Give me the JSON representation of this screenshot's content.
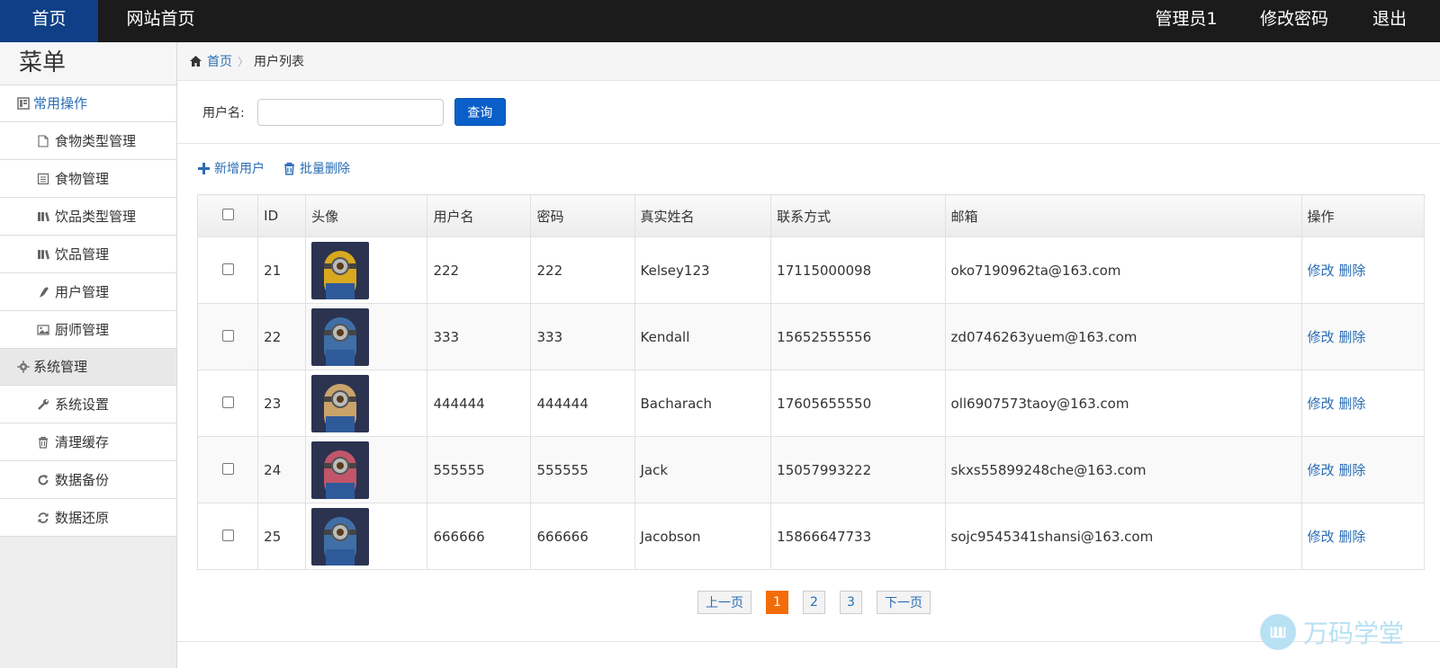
{
  "topbar": {
    "home": "首页",
    "site_home": "网站首页",
    "admin": "管理员1",
    "change_password": "修改密码",
    "logout": "退出"
  },
  "sidebar": {
    "title": "菜单",
    "group1": {
      "label": "常用操作",
      "icon": "list-icon"
    },
    "items1": [
      {
        "label": "食物类型管理",
        "icon": "file-icon"
      },
      {
        "label": "食物管理",
        "icon": "document-icon"
      },
      {
        "label": "饮品类型管理",
        "icon": "books-icon"
      },
      {
        "label": "饮品管理",
        "icon": "books-icon"
      },
      {
        "label": "用户管理",
        "icon": "user-icon"
      },
      {
        "label": "厨师管理",
        "icon": "image-icon"
      }
    ],
    "group2": {
      "label": "系统管理",
      "icon": "gear-icon"
    },
    "items2": [
      {
        "label": "系统设置",
        "icon": "wrench-icon"
      },
      {
        "label": "清理缓存",
        "icon": "trash-icon"
      },
      {
        "label": "数据备份",
        "icon": "refresh-icon"
      },
      {
        "label": "数据还原",
        "icon": "sync-icon"
      }
    ]
  },
  "breadcrumb": {
    "home": "首页",
    "sep": "〉",
    "current": "用户列表"
  },
  "search": {
    "label": "用户名:",
    "value": "",
    "placeholder": "",
    "button": "查询"
  },
  "actions": {
    "add": "新增用户",
    "batch_delete": "批量删除"
  },
  "table": {
    "headers": [
      "ID",
      "头像",
      "用户名",
      "密码",
      "真实姓名",
      "联系方式",
      "邮箱",
      "操作"
    ],
    "rows": [
      {
        "id": "21",
        "username": "222",
        "password": "222",
        "realname": "Kelsey123",
        "phone": "17115000098",
        "email": "oko7190962ta@163.com",
        "avatar_color": "#d8a81e"
      },
      {
        "id": "22",
        "username": "333",
        "password": "333",
        "realname": "Kendall",
        "phone": "15652555556",
        "email": "zd0746263yuem@163.com",
        "avatar_color": "#3f6fa6"
      },
      {
        "id": "23",
        "username": "444444",
        "password": "444444",
        "realname": "Bacharach",
        "phone": "17605655550",
        "email": "oll6907573taoy@163.com",
        "avatar_color": "#c9a36a"
      },
      {
        "id": "24",
        "username": "555555",
        "password": "555555",
        "realname": "Jack",
        "phone": "15057993222",
        "email": "skxs55899248che@163.com",
        "avatar_color": "#c2556a"
      },
      {
        "id": "25",
        "username": "666666",
        "password": "666666",
        "realname": "Jacobson",
        "phone": "15866647733",
        "email": "sojc9545341shansi@163.com",
        "avatar_color": "#3f6fa6"
      }
    ],
    "op_edit": "修改",
    "op_delete": "删除"
  },
  "pager": {
    "prev": "上一页",
    "pages": [
      "1",
      "2",
      "3"
    ],
    "current": "1",
    "next": "下一页"
  },
  "watermark": {
    "text": "万码学堂"
  }
}
